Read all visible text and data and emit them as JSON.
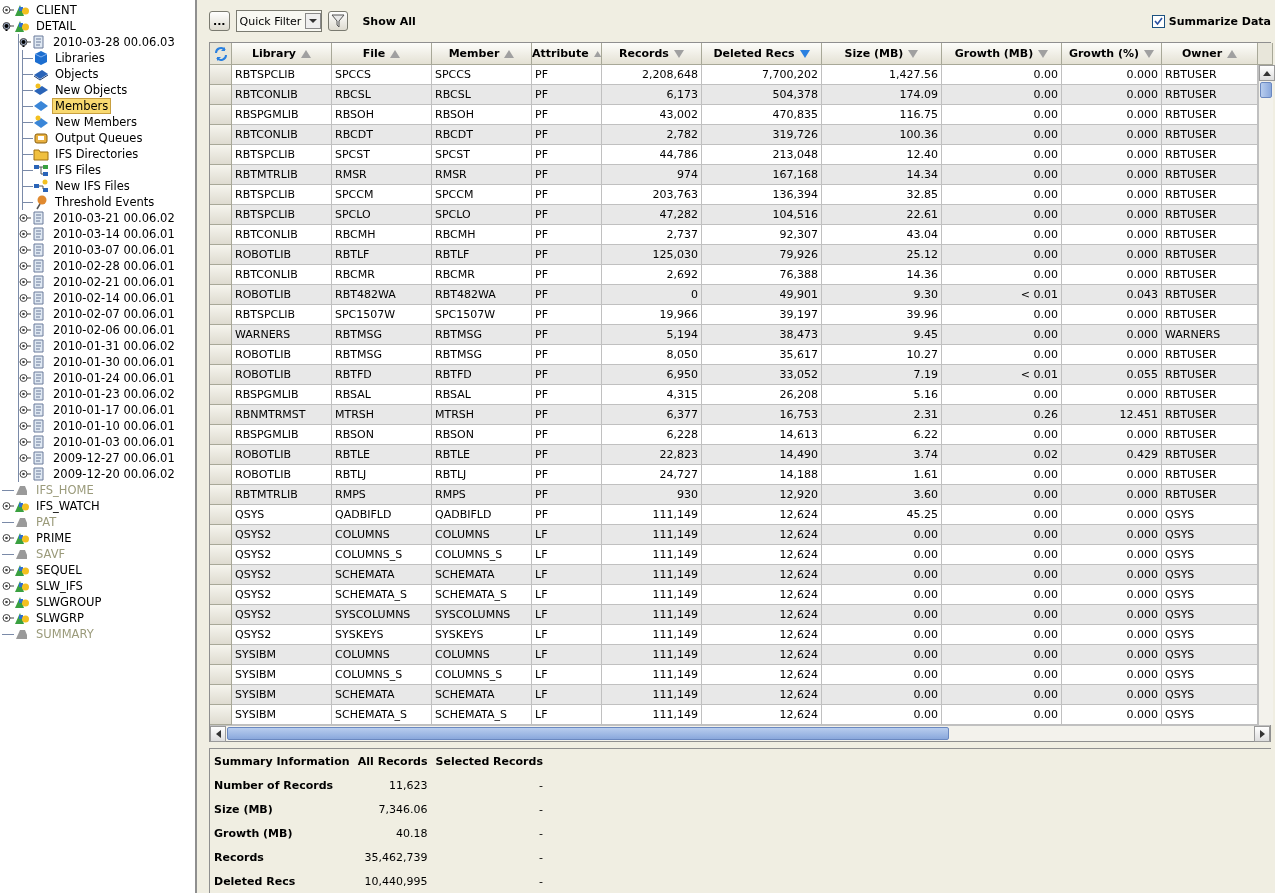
{
  "tree": [
    {
      "label": "CLIENT",
      "kind": "system",
      "expanded": false,
      "disabled": false
    },
    {
      "label": "DETAIL",
      "kind": "system",
      "expanded": true,
      "disabled": false,
      "children": [
        {
          "label": "2010-03-28  00.06.03",
          "kind": "snapshot",
          "expanded": true,
          "children": [
            {
              "label": "Libraries",
              "kind": "libraries",
              "selected": false
            },
            {
              "label": "Objects",
              "kind": "objects",
              "selected": false
            },
            {
              "label": "New Objects",
              "kind": "new-objects",
              "selected": false
            },
            {
              "label": "Members",
              "kind": "members",
              "selected": true
            },
            {
              "label": "New Members",
              "kind": "new-members",
              "selected": false
            },
            {
              "label": "Output Queues",
              "kind": "output-queues",
              "selected": false
            },
            {
              "label": "IFS Directories",
              "kind": "ifs-directories",
              "selected": false
            },
            {
              "label": "IFS Files",
              "kind": "ifs-files",
              "selected": false
            },
            {
              "label": "New IFS Files",
              "kind": "new-ifs-files",
              "selected": false
            },
            {
              "label": "Threshold Events",
              "kind": "threshold-events",
              "selected": false
            }
          ]
        },
        {
          "label": "2010-03-21  00.06.02",
          "kind": "snapshot",
          "expanded": false
        },
        {
          "label": "2010-03-14  00.06.01",
          "kind": "snapshot",
          "expanded": false
        },
        {
          "label": "2010-03-07  00.06.01",
          "kind": "snapshot",
          "expanded": false
        },
        {
          "label": "2010-02-28  00.06.01",
          "kind": "snapshot",
          "expanded": false
        },
        {
          "label": "2010-02-21  00.06.01",
          "kind": "snapshot",
          "expanded": false
        },
        {
          "label": "2010-02-14  00.06.01",
          "kind": "snapshot",
          "expanded": false
        },
        {
          "label": "2010-02-07  00.06.01",
          "kind": "snapshot",
          "expanded": false
        },
        {
          "label": "2010-02-06  00.06.01",
          "kind": "snapshot",
          "expanded": false
        },
        {
          "label": "2010-01-31  00.06.02",
          "kind": "snapshot",
          "expanded": false
        },
        {
          "label": "2010-01-30  00.06.01",
          "kind": "snapshot",
          "expanded": false
        },
        {
          "label": "2010-01-24  00.06.01",
          "kind": "snapshot",
          "expanded": false
        },
        {
          "label": "2010-01-23  00.06.02",
          "kind": "snapshot",
          "expanded": false
        },
        {
          "label": "2010-01-17  00.06.01",
          "kind": "snapshot",
          "expanded": false
        },
        {
          "label": "2010-01-10  00.06.01",
          "kind": "snapshot",
          "expanded": false
        },
        {
          "label": "2010-01-03  00.06.01",
          "kind": "snapshot",
          "expanded": false
        },
        {
          "label": "2009-12-27  00.06.01",
          "kind": "snapshot",
          "expanded": false
        },
        {
          "label": "2009-12-20  00.06.02",
          "kind": "snapshot",
          "expanded": false
        }
      ]
    },
    {
      "label": "IFS_HOME",
      "kind": "system",
      "disabled": true
    },
    {
      "label": "IFS_WATCH",
      "kind": "system",
      "expanded": false,
      "disabled": false
    },
    {
      "label": "PAT",
      "kind": "system",
      "disabled": true
    },
    {
      "label": "PRIME",
      "kind": "system",
      "expanded": false,
      "disabled": false
    },
    {
      "label": "SAVF",
      "kind": "system",
      "disabled": true
    },
    {
      "label": "SEQUEL",
      "kind": "system",
      "expanded": false,
      "disabled": false
    },
    {
      "label": "SLW_IFS",
      "kind": "system",
      "expanded": false,
      "disabled": false
    },
    {
      "label": "SLWGROUP",
      "kind": "system",
      "expanded": false,
      "disabled": false
    },
    {
      "label": "SLWGRP",
      "kind": "system",
      "expanded": false,
      "disabled": false
    },
    {
      "label": "SUMMARY",
      "kind": "system",
      "disabled": true
    }
  ],
  "toolbar": {
    "more": "...",
    "quick_filter": "Quick Filter",
    "show_all": "Show All",
    "summarize": {
      "label": "Summarize Data",
      "checked": true
    }
  },
  "table": {
    "columns": [
      {
        "label": "Library",
        "ascending": true,
        "sorted": false,
        "numeric": false
      },
      {
        "label": "File",
        "ascending": true,
        "sorted": false,
        "numeric": false
      },
      {
        "label": "Member",
        "ascending": true,
        "sorted": false,
        "numeric": false
      },
      {
        "label": "Attribute",
        "ascending": true,
        "sorted": false,
        "numeric": false
      },
      {
        "label": "Records",
        "ascending": false,
        "sorted": false,
        "numeric": true
      },
      {
        "label": "Deleted Recs",
        "ascending": false,
        "sorted": true,
        "numeric": true
      },
      {
        "label": "Size (MB)",
        "ascending": false,
        "sorted": false,
        "numeric": true
      },
      {
        "label": "Growth (MB)",
        "ascending": false,
        "sorted": false,
        "numeric": true
      },
      {
        "label": "Growth (%)",
        "ascending": false,
        "sorted": false,
        "numeric": true
      },
      {
        "label": "Owner",
        "ascending": true,
        "sorted": false,
        "numeric": false
      }
    ],
    "rows": [
      [
        "RBTSPCLIB",
        "SPCCS",
        "SPCCS",
        "PF",
        "2,208,648",
        "7,700,202",
        "1,427.56",
        "0.00",
        "0.000",
        "RBTUSER"
      ],
      [
        "RBTCONLIB",
        "RBCSL",
        "RBCSL",
        "PF",
        "6,173",
        "504,378",
        "174.09",
        "0.00",
        "0.000",
        "RBTUSER"
      ],
      [
        "RBSPGMLIB",
        "RBSOH",
        "RBSOH",
        "PF",
        "43,002",
        "470,835",
        "116.75",
        "0.00",
        "0.000",
        "RBTUSER"
      ],
      [
        "RBTCONLIB",
        "RBCDT",
        "RBCDT",
        "PF",
        "2,782",
        "319,726",
        "100.36",
        "0.00",
        "0.000",
        "RBTUSER"
      ],
      [
        "RBTSPCLIB",
        "SPCST",
        "SPCST",
        "PF",
        "44,786",
        "213,048",
        "12.40",
        "0.00",
        "0.000",
        "RBTUSER"
      ],
      [
        "RBTMTRLIB",
        "RMSR",
        "RMSR",
        "PF",
        "974",
        "167,168",
        "14.34",
        "0.00",
        "0.000",
        "RBTUSER"
      ],
      [
        "RBTSPCLIB",
        "SPCCM",
        "SPCCM",
        "PF",
        "203,763",
        "136,394",
        "32.85",
        "0.00",
        "0.000",
        "RBTUSER"
      ],
      [
        "RBTSPCLIB",
        "SPCLO",
        "SPCLO",
        "PF",
        "47,282",
        "104,516",
        "22.61",
        "0.00",
        "0.000",
        "RBTUSER"
      ],
      [
        "RBTCONLIB",
        "RBCMH",
        "RBCMH",
        "PF",
        "2,737",
        "92,307",
        "43.04",
        "0.00",
        "0.000",
        "RBTUSER"
      ],
      [
        "ROBOTLIB",
        "RBTLF",
        "RBTLF",
        "PF",
        "125,030",
        "79,926",
        "25.12",
        "0.00",
        "0.000",
        "RBTUSER"
      ],
      [
        "RBTCONLIB",
        "RBCMR",
        "RBCMR",
        "PF",
        "2,692",
        "76,388",
        "14.36",
        "0.00",
        "0.000",
        "RBTUSER"
      ],
      [
        "ROBOTLIB",
        "RBT482WA",
        "RBT482WA",
        "PF",
        "0",
        "49,901",
        "9.30",
        "< 0.01",
        "0.043",
        "RBTUSER"
      ],
      [
        "RBTSPCLIB",
        "SPC1507W",
        "SPC1507W",
        "PF",
        "19,966",
        "39,197",
        "39.96",
        "0.00",
        "0.000",
        "RBTUSER"
      ],
      [
        "WARNERS",
        "RBTMSG",
        "RBTMSG",
        "PF",
        "5,194",
        "38,473",
        "9.45",
        "0.00",
        "0.000",
        "WARNERS"
      ],
      [
        "ROBOTLIB",
        "RBTMSG",
        "RBTMSG",
        "PF",
        "8,050",
        "35,617",
        "10.27",
        "0.00",
        "0.000",
        "RBTUSER"
      ],
      [
        "ROBOTLIB",
        "RBTFD",
        "RBTFD",
        "PF",
        "6,950",
        "33,052",
        "7.19",
        "< 0.01",
        "0.055",
        "RBTUSER"
      ],
      [
        "RBSPGMLIB",
        "RBSAL",
        "RBSAL",
        "PF",
        "4,315",
        "26,208",
        "5.16",
        "0.00",
        "0.000",
        "RBTUSER"
      ],
      [
        "RBNMTRMST",
        "MTRSH",
        "MTRSH",
        "PF",
        "6,377",
        "16,753",
        "2.31",
        "0.26",
        "12.451",
        "RBTUSER"
      ],
      [
        "RBSPGMLIB",
        "RBSON",
        "RBSON",
        "PF",
        "6,228",
        "14,613",
        "6.22",
        "0.00",
        "0.000",
        "RBTUSER"
      ],
      [
        "ROBOTLIB",
        "RBTLE",
        "RBTLE",
        "PF",
        "22,823",
        "14,490",
        "3.74",
        "0.02",
        "0.429",
        "RBTUSER"
      ],
      [
        "ROBOTLIB",
        "RBTLJ",
        "RBTLJ",
        "PF",
        "24,727",
        "14,188",
        "1.61",
        "0.00",
        "0.000",
        "RBTUSER"
      ],
      [
        "RBTMTRLIB",
        "RMPS",
        "RMPS",
        "PF",
        "930",
        "12,920",
        "3.60",
        "0.00",
        "0.000",
        "RBTUSER"
      ],
      [
        "QSYS",
        "QADBIFLD",
        "QADBIFLD",
        "PF",
        "111,149",
        "12,624",
        "45.25",
        "0.00",
        "0.000",
        "QSYS"
      ],
      [
        "QSYS2",
        "COLUMNS",
        "COLUMNS",
        "LF",
        "111,149",
        "12,624",
        "0.00",
        "0.00",
        "0.000",
        "QSYS"
      ],
      [
        "QSYS2",
        "COLUMNS_S",
        "COLUMNS_S",
        "LF",
        "111,149",
        "12,624",
        "0.00",
        "0.00",
        "0.000",
        "QSYS"
      ],
      [
        "QSYS2",
        "SCHEMATA",
        "SCHEMATA",
        "LF",
        "111,149",
        "12,624",
        "0.00",
        "0.00",
        "0.000",
        "QSYS"
      ],
      [
        "QSYS2",
        "SCHEMATA_S",
        "SCHEMATA_S",
        "LF",
        "111,149",
        "12,624",
        "0.00",
        "0.00",
        "0.000",
        "QSYS"
      ],
      [
        "QSYS2",
        "SYSCOLUMNS",
        "SYSCOLUMNS",
        "LF",
        "111,149",
        "12,624",
        "0.00",
        "0.00",
        "0.000",
        "QSYS"
      ],
      [
        "QSYS2",
        "SYSKEYS",
        "SYSKEYS",
        "LF",
        "111,149",
        "12,624",
        "0.00",
        "0.00",
        "0.000",
        "QSYS"
      ],
      [
        "SYSIBM",
        "COLUMNS",
        "COLUMNS",
        "LF",
        "111,149",
        "12,624",
        "0.00",
        "0.00",
        "0.000",
        "QSYS"
      ],
      [
        "SYSIBM",
        "COLUMNS_S",
        "COLUMNS_S",
        "LF",
        "111,149",
        "12,624",
        "0.00",
        "0.00",
        "0.000",
        "QSYS"
      ],
      [
        "SYSIBM",
        "SCHEMATA",
        "SCHEMATA",
        "LF",
        "111,149",
        "12,624",
        "0.00",
        "0.00",
        "0.000",
        "QSYS"
      ],
      [
        "SYSIBM",
        "SCHEMATA_S",
        "SCHEMATA_S",
        "LF",
        "111,149",
        "12,624",
        "0.00",
        "0.00",
        "0.000",
        "QSYS"
      ]
    ]
  },
  "summary": {
    "columns": [
      "Summary Information",
      "All Records",
      "Selected Records"
    ],
    "rows": [
      [
        "Number of Records",
        "11,623",
        "-"
      ],
      [
        "Size (MB)",
        "7,346.06",
        "-"
      ],
      [
        "Growth (MB)",
        "40.18",
        "-"
      ],
      [
        "Records",
        "35,462,739",
        "-"
      ],
      [
        "Deleted Recs",
        "10,440,995",
        "-"
      ]
    ]
  }
}
